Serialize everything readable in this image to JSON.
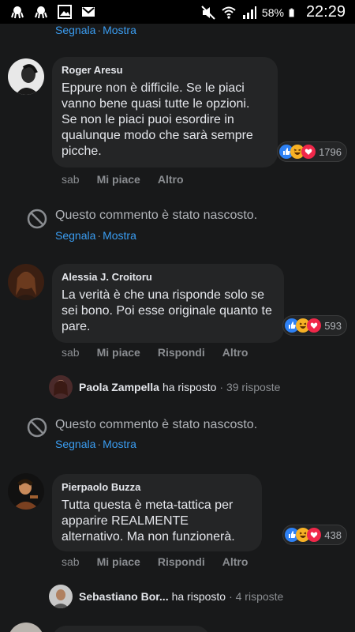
{
  "statusbar": {
    "battery": "58%",
    "time": "22:29",
    "left_icons": [
      "octopus-icon",
      "octopus-icon",
      "image-icon",
      "gmail-icon"
    ],
    "right_icons": [
      "mute-icon",
      "wifi-icon",
      "signal-icon",
      "battery-icon"
    ]
  },
  "colors": {
    "link": "#3a9cf0",
    "muted": "#8a8d91",
    "bubble": "#242526",
    "bg": "#18191a"
  },
  "feed": {
    "top_hidden": {
      "actions": [
        "Segnala",
        "Mostra"
      ]
    },
    "comment1": {
      "author": "Roger Aresu",
      "text": "Eppure non è difficile. Se le piaci vanno bene quasi tutte le opzioni. Se non le piaci puoi esordire in qualunque modo che sarà sempre picche.",
      "reactions": [
        "like",
        "haha",
        "love"
      ],
      "reaction_count": "1796",
      "actions": [
        "sab",
        "Mi piace",
        "Altro"
      ]
    },
    "hidden1": {
      "text": "Questo commento è stato nascosto.",
      "actions": [
        "Segnala",
        "Mostra"
      ]
    },
    "comment2": {
      "author": "Alessia J. Croitoru",
      "text": "La verità è che una risponde solo se sei bono. Poi esse originale quanto te pare.",
      "reactions": [
        "like",
        "haha",
        "love"
      ],
      "reaction_count": "593",
      "actions": [
        "sab",
        "Mi piace",
        "Rispondi",
        "Altro"
      ],
      "reply": {
        "name": "Paola Zampella",
        "verb": "ha risposto",
        "count": "· 39 risposte"
      }
    },
    "hidden2": {
      "text": "Questo commento è stato nascosto.",
      "actions": [
        "Segnala",
        "Mostra"
      ]
    },
    "comment3": {
      "author": "Pierpaolo Buzza",
      "text": "Tutta questa è meta-tattica per apparire REALMENTE alternativo. Ma non funzionerà.",
      "reactions": [
        "like",
        "haha",
        "love"
      ],
      "reaction_count": "438",
      "actions": [
        "sab",
        "Mi piace",
        "Rispondi",
        "Altro"
      ],
      "reply": {
        "name": "Sebastiano Bor...",
        "verb": "ha risposto",
        "count": "· 4 risposte"
      }
    }
  }
}
